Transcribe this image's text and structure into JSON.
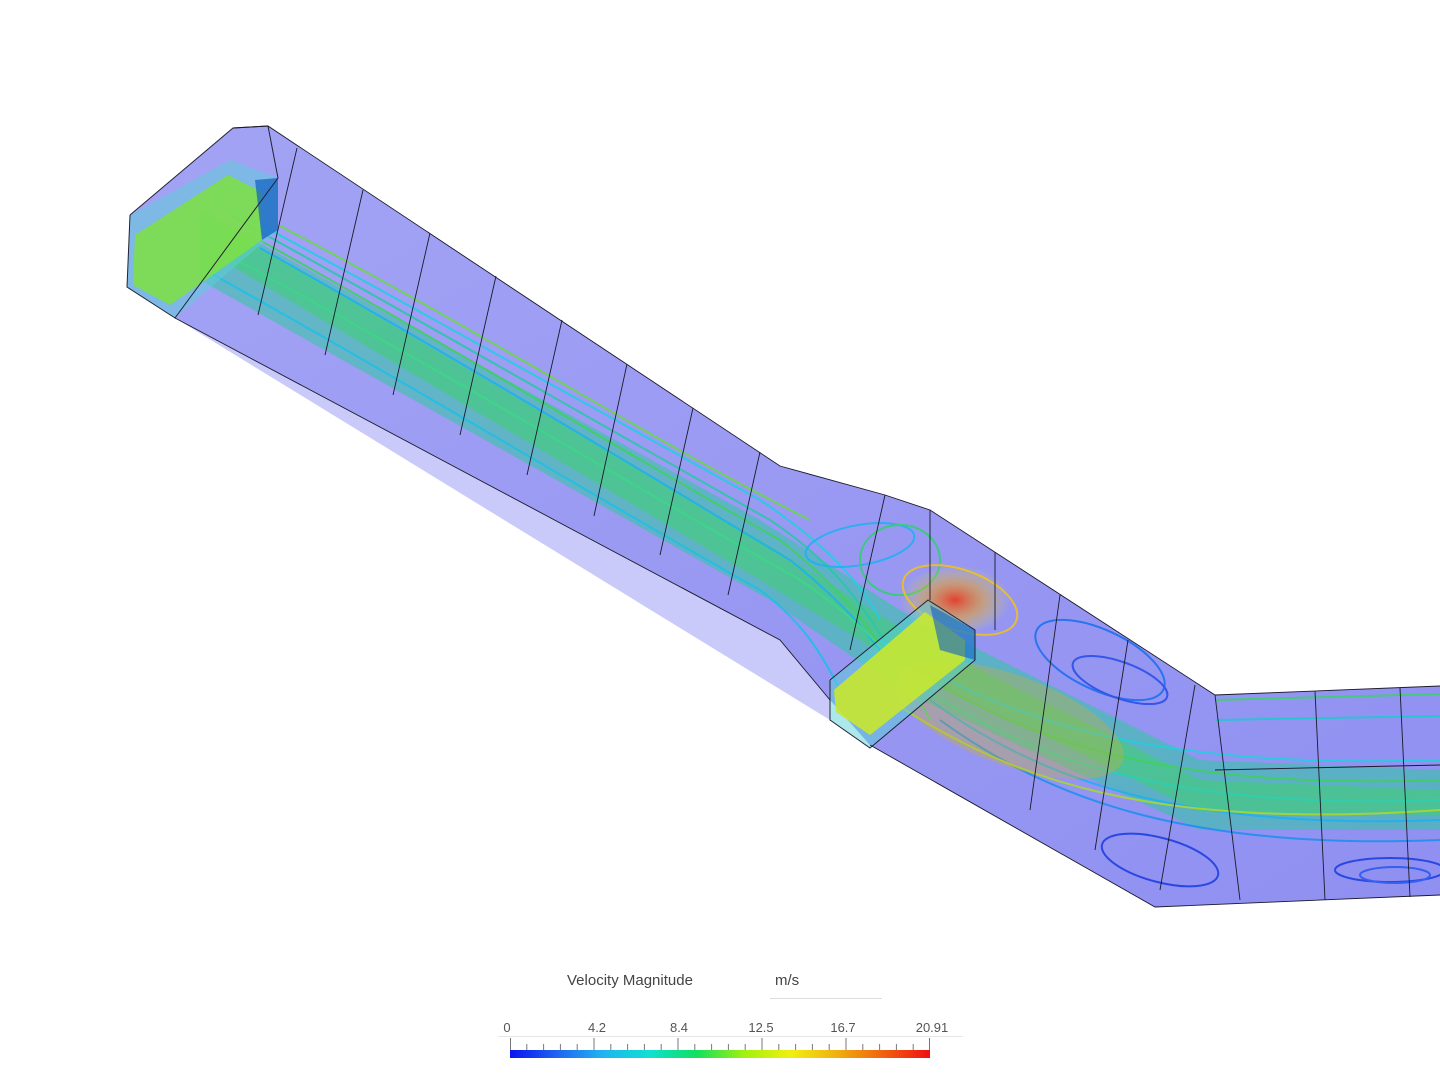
{
  "legend": {
    "title": "Velocity Magnitude",
    "unit": "m/s",
    "min": 0,
    "max": 20.91,
    "ticks": [
      "0",
      "4.2",
      "8.4",
      "12.5",
      "16.7",
      "20.91"
    ],
    "colors": [
      "#0a14f0",
      "#1e64f0",
      "#20b4f0",
      "#10e0d0",
      "#10e060",
      "#a0f010",
      "#f0f010",
      "#f0b010",
      "#f06010",
      "#f01010"
    ]
  },
  "colors": {
    "duct_fill": "#8c8cf2",
    "duct_edge": "#1a1a2a",
    "inlet_fill": "#5ad0d8"
  }
}
